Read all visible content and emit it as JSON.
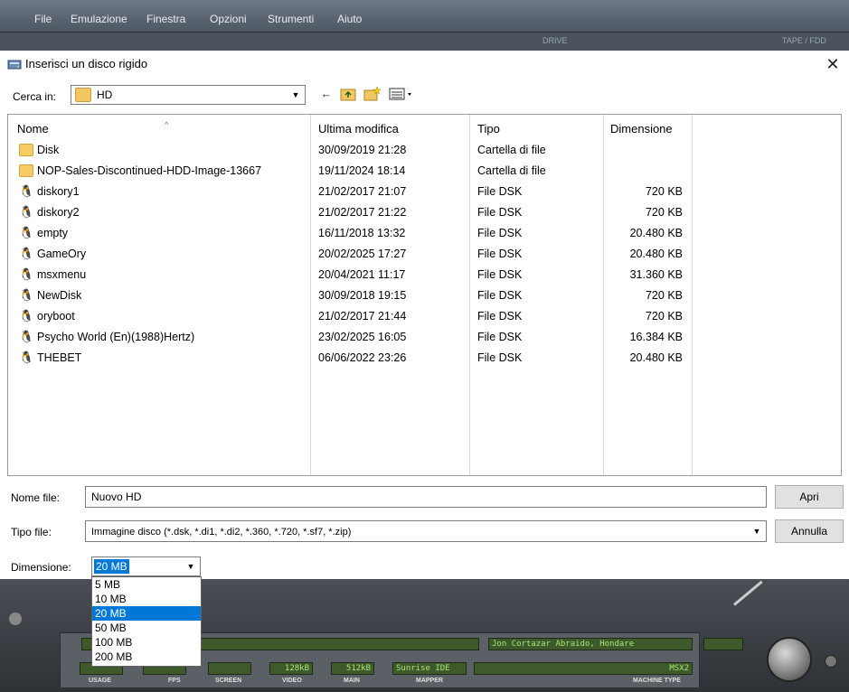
{
  "emulator": {
    "menu": [
      "File",
      "Emulazione",
      "Finestra",
      "Opzioni",
      "Strumenti",
      "Aiuto"
    ],
    "strip_labels": [
      "DRIVE",
      "TAPE / FDD"
    ],
    "lcd": {
      "machine_text": "Jon Cortazar Abraido, Hondare",
      "video": "128kB",
      "main": "512kB",
      "mapper": "Sunrise IDE",
      "machine_type": "MSX2"
    },
    "labels": [
      "USAGE",
      "FPS",
      "SCREEN",
      "VIDEO",
      "MAIN",
      "MAPPER",
      "MACHINE TYPE"
    ]
  },
  "dialog": {
    "title": "Inserisci un disco rigido",
    "close_glyph": "✕",
    "look_in_label": "Cerca in:",
    "look_in_value": "HD",
    "columns": [
      "Nome",
      "Ultima modifica",
      "Tipo",
      "Dimensione"
    ],
    "files": [
      {
        "name": "Disk",
        "modified": "30/09/2019 21:28",
        "type": "Cartella di file",
        "size": "",
        "kind": "folder"
      },
      {
        "name": "NOP-Sales-Discontinued-HDD-Image-13667",
        "modified": "19/11/2024 18:14",
        "type": "Cartella di file",
        "size": "",
        "kind": "folder"
      },
      {
        "name": "diskory1",
        "modified": "21/02/2017 21:07",
        "type": "File DSK",
        "size": "720 KB",
        "kind": "dsk"
      },
      {
        "name": "diskory2",
        "modified": "21/02/2017 21:22",
        "type": "File DSK",
        "size": "720 KB",
        "kind": "dsk"
      },
      {
        "name": "empty",
        "modified": "16/11/2018 13:32",
        "type": "File DSK",
        "size": "20.480 KB",
        "kind": "dsk"
      },
      {
        "name": "GameOry",
        "modified": "20/02/2025 17:27",
        "type": "File DSK",
        "size": "20.480 KB",
        "kind": "dsk"
      },
      {
        "name": "msxmenu",
        "modified": "20/04/2021 11:17",
        "type": "File DSK",
        "size": "31.360 KB",
        "kind": "dsk"
      },
      {
        "name": "NewDisk",
        "modified": "30/09/2018 19:15",
        "type": "File DSK",
        "size": "720 KB",
        "kind": "dsk"
      },
      {
        "name": "oryboot",
        "modified": "21/02/2017 21:44",
        "type": "File DSK",
        "size": "720 KB",
        "kind": "dsk"
      },
      {
        "name": "Psycho World (En)(1988)Hertz)",
        "modified": "23/02/2025 16:05",
        "type": "File DSK",
        "size": "16.384 KB",
        "kind": "dsk"
      },
      {
        "name": "THEBET",
        "modified": "06/06/2022 23:26",
        "type": "File DSK",
        "size": "20.480 KB",
        "kind": "dsk"
      }
    ],
    "filename_label": "Nome file:",
    "filename_value": "Nuovo HD",
    "filetype_label": "Tipo file:",
    "filetype_value": "Immagine disco  (*.dsk, *.di1, *.di2, *.360, *.720, *.sf7, *.zip)",
    "open_label": "Apri",
    "cancel_label": "Annulla",
    "size_label": "Dimensione:",
    "size_value": "20 MB",
    "size_options": [
      "5 MB",
      "10 MB",
      "20 MB",
      "50 MB",
      "100 MB",
      "200 MB"
    ],
    "size_selected_index": 2
  }
}
